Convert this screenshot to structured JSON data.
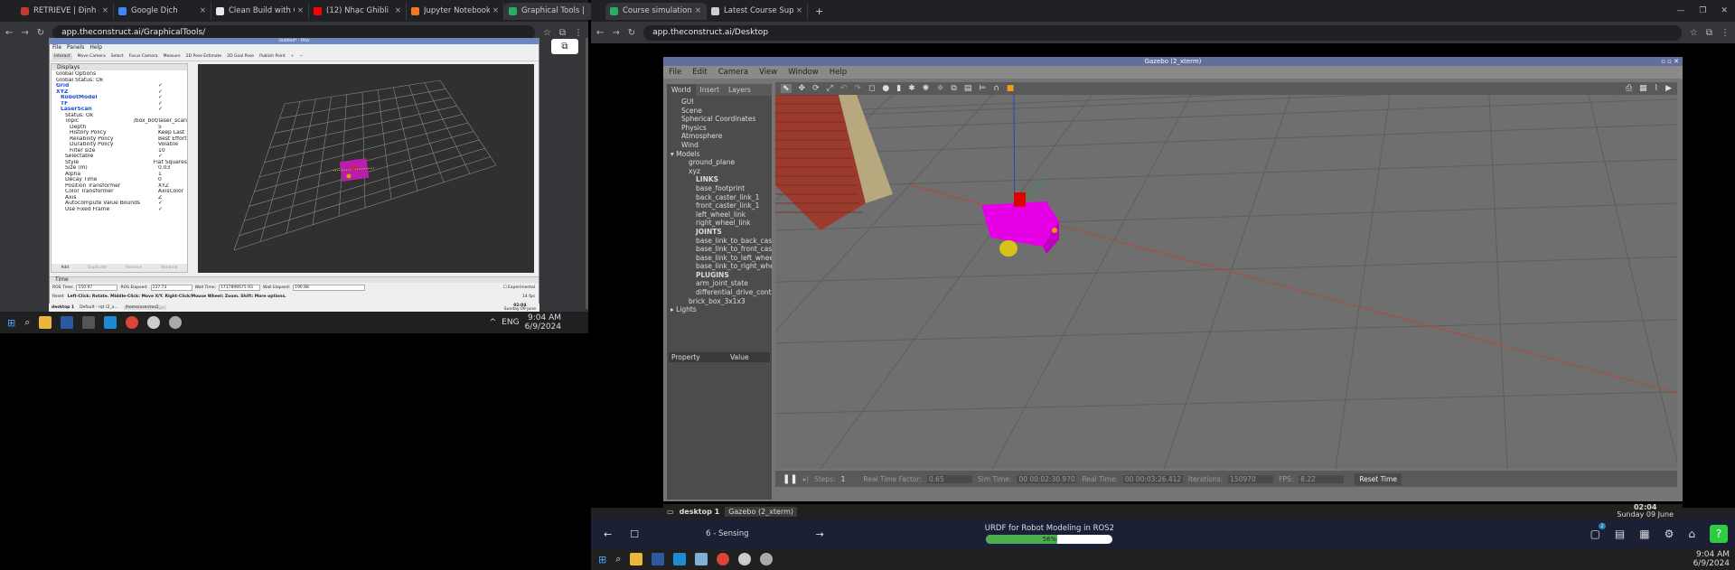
{
  "left_browser": {
    "tabs": [
      {
        "label": "RETRIEVE | Định nghĩ",
        "color": "#c0392b"
      },
      {
        "label": "Google Dịch",
        "color": "#4285f4"
      },
      {
        "label": "Clean Build with Col",
        "color": "#e8e8e8"
      },
      {
        "label": "(12) Nhạc Ghibli",
        "color": "#ff0000"
      },
      {
        "label": "Jupyter Notebook -",
        "color": "#f37726"
      },
      {
        "label": "Graphical Tools | Rob",
        "color": "#27ae60"
      }
    ],
    "url": "app.theconstruct.ai/GraphicalTools/"
  },
  "rviz": {
    "title": "Untitled* - RViz",
    "menu": [
      "File",
      "Panels",
      "Help"
    ],
    "toolbar": [
      "Interact",
      "Move Camera",
      "Select",
      "Focus Camera",
      "Measure",
      "2D Pose Estimate",
      "2D Goal Pose",
      "Publish Point"
    ],
    "displays_title": "Displays",
    "tree": [
      {
        "n": "Global Options",
        "v": "",
        "d": 1,
        "c": "#222"
      },
      {
        "n": "Global Status: Ok",
        "v": "",
        "d": 1,
        "c": "#222"
      },
      {
        "n": "Grid",
        "v": "✓",
        "d": 1,
        "c": "#1f4fd1"
      },
      {
        "n": "XYZ",
        "v": "✓",
        "d": 1,
        "c": "#1f4fd1"
      },
      {
        "n": "RobotModel",
        "v": "✓",
        "d": 2,
        "c": "#1f4fd1"
      },
      {
        "n": "TF",
        "v": "✓",
        "d": 2,
        "c": "#1f4fd1"
      },
      {
        "n": "LaserScan",
        "v": "✓",
        "d": 2,
        "c": "#1f4fd1"
      },
      {
        "n": "Status: Ok",
        "v": "",
        "d": 3,
        "c": "#222"
      },
      {
        "n": "Topic",
        "v": "/box_bot/laser_scan",
        "d": 3,
        "c": "#222"
      },
      {
        "n": "Depth",
        "v": "5",
        "d": 4,
        "c": "#222"
      },
      {
        "n": "History Policy",
        "v": "Keep Last",
        "d": 4,
        "c": "#222"
      },
      {
        "n": "Reliability Policy",
        "v": "Best Effort",
        "d": 4,
        "c": "#222"
      },
      {
        "n": "Durability Policy",
        "v": "Volatile",
        "d": 4,
        "c": "#222"
      },
      {
        "n": "Filter size",
        "v": "10",
        "d": 4,
        "c": "#222"
      },
      {
        "n": "Selectable",
        "v": "✓",
        "d": 3,
        "c": "#222"
      },
      {
        "n": "Style",
        "v": "Flat Squares",
        "d": 3,
        "c": "#222"
      },
      {
        "n": "Size (m)",
        "v": "0.03",
        "d": 3,
        "c": "#222"
      },
      {
        "n": "Alpha",
        "v": "1",
        "d": 3,
        "c": "#222"
      },
      {
        "n": "Decay Time",
        "v": "0",
        "d": 3,
        "c": "#222"
      },
      {
        "n": "Position Transformer",
        "v": "XYZ",
        "d": 3,
        "c": "#222"
      },
      {
        "n": "Color Transformer",
        "v": "AxisColor",
        "d": 3,
        "c": "#222"
      },
      {
        "n": "Axis",
        "v": "Z",
        "d": 3,
        "c": "#222"
      },
      {
        "n": "Autocompute Value Bounds",
        "v": "✓",
        "d": 3,
        "c": "#222"
      },
      {
        "n": "Use Fixed Frame",
        "v": "✓",
        "d": 3,
        "c": "#222"
      }
    ],
    "buttons": [
      "Add",
      "Duplicate",
      "Remove",
      "Rename"
    ],
    "time_title": "Time",
    "ros_time_label": "ROS Time:",
    "ros_time": "150.97",
    "ros_elapsed_label": "ROS Elapsed:",
    "ros_elapsed": "137.73",
    "wall_time_label": "Wall Time:",
    "wall_time": "1717896675.93",
    "wall_elapsed_label": "Wall Elapsed:",
    "wall_elapsed": "190.88",
    "experimental": "Experimental",
    "reset": "Reset",
    "hint": "Left-Click: Rotate. Middle-Click: Move X/Y. Right-Click/Mouse Wheel: Zoom. Shift: More options.",
    "fps": "14 fps"
  },
  "left_vdesk": {
    "desktop": "desktop 1",
    "item1": "Default - rqt (2_x...",
    "item2": "/home/user/ros2_...",
    "time": "02:04",
    "date": "Sunday 09 June"
  },
  "left_win_taskbar": {
    "time": "9:04 AM",
    "date": "6/9/2024",
    "lang": "ENG"
  },
  "right_browser": {
    "tabs": [
      {
        "label": "Course simulation - URDF for R",
        "color": "#27ae60"
      },
      {
        "label": "Latest Course Support/URDF fc",
        "color": "#cccccc"
      }
    ],
    "url": "app.theconstruct.ai/Desktop"
  },
  "gazebo": {
    "title": "Gazebo (2_xterm)",
    "menu": [
      "File",
      "Edit",
      "Camera",
      "View",
      "Window",
      "Help"
    ],
    "tabs": [
      "World",
      "Insert",
      "Layers"
    ],
    "tree": [
      {
        "t": "GUI",
        "d": 0,
        "b": false
      },
      {
        "t": "Scene",
        "d": 0,
        "b": false
      },
      {
        "t": "Spherical Coordinates",
        "d": 0,
        "b": false
      },
      {
        "t": "Physics",
        "d": 0,
        "b": false
      },
      {
        "t": "Atmosphere",
        "d": 0,
        "b": false
      },
      {
        "t": "Wind",
        "d": 0,
        "b": false
      },
      {
        "t": "Models",
        "d": -1,
        "b": false
      },
      {
        "t": "ground_plane",
        "d": 1,
        "b": false
      },
      {
        "t": "xyz",
        "d": 1,
        "b": false
      },
      {
        "t": "LINKS",
        "d": 2,
        "b": true
      },
      {
        "t": "base_footprint",
        "d": 2,
        "b": false
      },
      {
        "t": "back_caster_link_1",
        "d": 2,
        "b": false
      },
      {
        "t": "front_caster_link_1",
        "d": 2,
        "b": false
      },
      {
        "t": "left_wheel_link",
        "d": 2,
        "b": false
      },
      {
        "t": "right_wheel_link",
        "d": 2,
        "b": false
      },
      {
        "t": "JOINTS",
        "d": 2,
        "b": true
      },
      {
        "t": "base_link_to_back_cast...",
        "d": 2,
        "b": false
      },
      {
        "t": "base_link_to_front_cast...",
        "d": 2,
        "b": false
      },
      {
        "t": "base_link_to_left_wheel...",
        "d": 2,
        "b": false
      },
      {
        "t": "base_link_to_right_whe...",
        "d": 2,
        "b": false
      },
      {
        "t": "PLUGINS",
        "d": 2,
        "b": true
      },
      {
        "t": "arm_joint_state",
        "d": 2,
        "b": false
      },
      {
        "t": "differential_drive_contr...",
        "d": 2,
        "b": false
      },
      {
        "t": "brick_box_3x1x3",
        "d": 1,
        "b": false
      },
      {
        "t": "Lights",
        "d": -1,
        "b": false
      }
    ],
    "prop_header": "Property",
    "value_header": "Value",
    "steps_label": "Steps:",
    "steps": "1",
    "rtf_label": "Real Time Factor:",
    "rtf": "0.65",
    "sim_label": "Sim Time:",
    "sim": "00 00:02:30.970",
    "real_label": "Real Time:",
    "real": "00 00:03:26.412",
    "iter_label": "Iterations:",
    "iter": "150970",
    "fps_label": "FPS:",
    "fps": "8.22",
    "reset": "Reset Time"
  },
  "right_vdesk": {
    "desktop": "desktop 1",
    "item": "Gazebo (2_xterm)",
    "time": "02:04",
    "date": "Sunday 09 June"
  },
  "course": {
    "lesson": "6 - Sensing",
    "title": "URDF for Robot Modeling in ROS2",
    "progress_label": "56%",
    "progress": 0.56,
    "badge": "2",
    "help": "?"
  },
  "right_win_taskbar": {
    "time": "9:04 AM",
    "date": "6/9/2024"
  }
}
